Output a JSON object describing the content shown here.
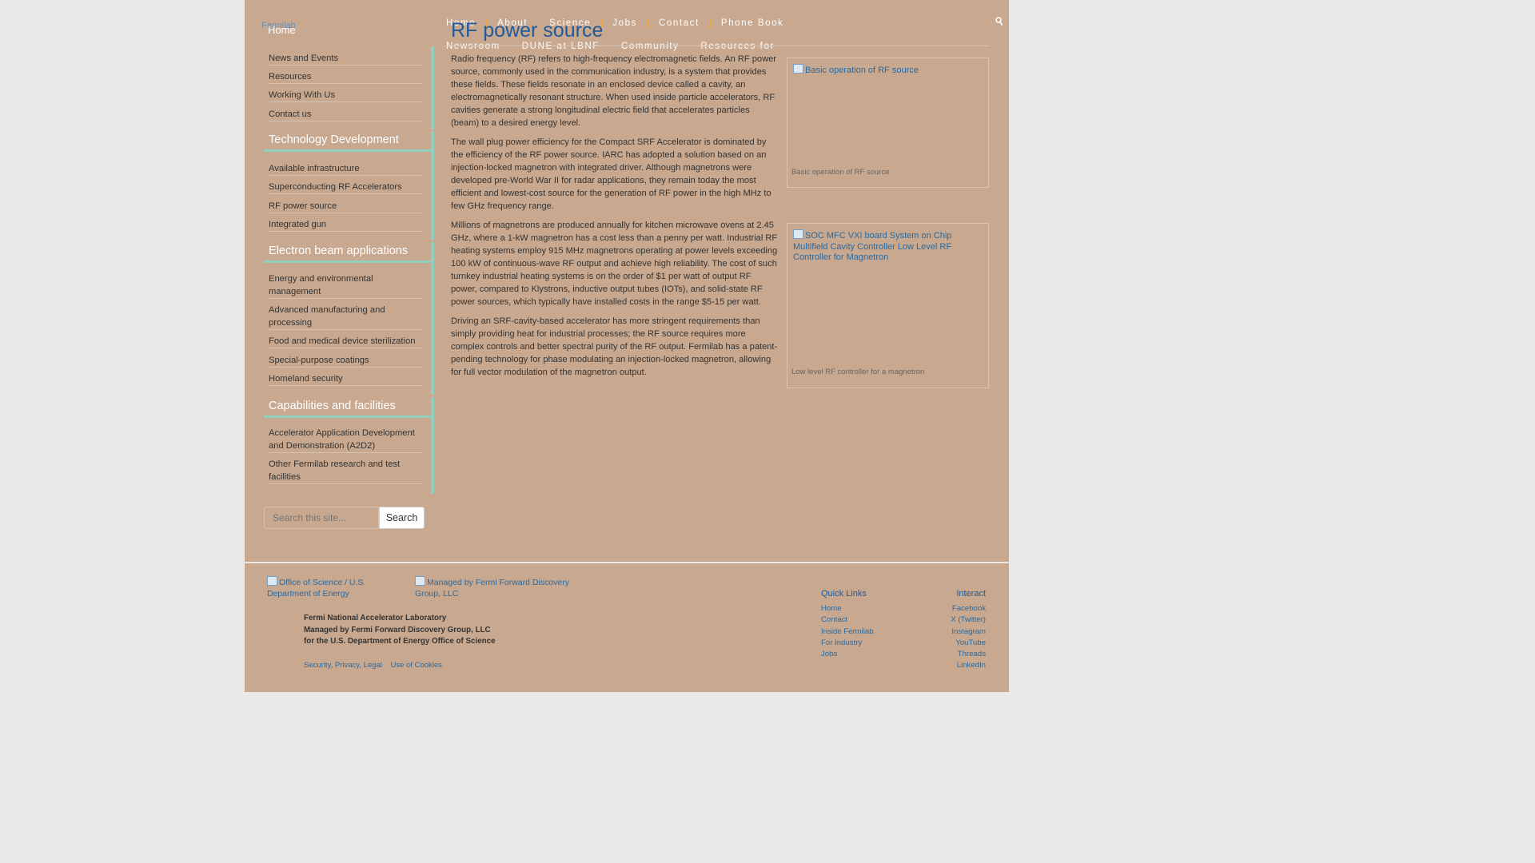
{
  "header": {
    "logo_alt": "Fermilab",
    "home_crumb": "Home",
    "nav_top": [
      "Home",
      "About",
      "Science",
      "Jobs",
      "Contact",
      "Phone Book"
    ],
    "nav_bottom": [
      "Newsroom",
      "DUNE at LBNF",
      "Community",
      "Resources for"
    ],
    "search_icon": "search-icon"
  },
  "sidebar": {
    "group1_items": [
      "News and Events",
      "Resources",
      "Working With Us",
      "Contact us"
    ],
    "group2": {
      "title": "Technology Development",
      "items": [
        "Available infrastructure",
        "Superconducting RF Accelerators",
        "RF power source",
        "Integrated gun"
      ]
    },
    "group3": {
      "title": "Electron beam applications",
      "items": [
        "Energy and environmental management",
        "Advanced manufacturing and processing",
        "Food and medical device sterilization",
        "Special-purpose coatings",
        "Homeland security"
      ]
    },
    "group4": {
      "title": "Capabilities and facilities",
      "items": [
        "Accelerator Application Development and Demonstration (A2D2)",
        "Other Fermilab research and test facilities"
      ]
    },
    "search": {
      "placeholder": "Search this site...",
      "button": "Search"
    }
  },
  "main": {
    "title": "RF power source",
    "paragraphs": [
      "Radio frequency (RF) refers to high-frequency electromagnetic fields. An RF power source, commonly used in the communication industry, is a system that provides these fields. These fields resonate in an enclosed device called a cavity, an electromagnetically resonant structure. When used inside particle accelerators, RF cavities generate a strong longitudinal electric field that accelerates particles (beam) to a desired energy level.",
      "The wall plug power efficiency for the Compact SRF Accelerator is dominated by the efficiency of the RF power source. IARC has adopted a solution based on an injection-locked magnetron with integrated driver. Although magnetrons were developed pre-World War II for radar applications, they remain today the most efficient and lowest-cost source for the generation of RF power in the high MHz to few GHz frequency range.",
      "Millions of magnetrons are produced annually for kitchen microwave ovens at 2.45 GHz, where a 1-kW magnetron has a cost less than a penny per watt. Industrial RF heating systems employ 915 MHz magnetrons operating at power levels exceeding 100 kW of continuous-wave RF output and achieve high reliability. The cost of such turnkey industrial heating systems is on the order of $1 per watt of output RF power, compared to Klystrons, inductive output tubes (IOTs), and solid-state RF power sources, which typically have installed costs in the range $5-15 per watt.",
      "Driving an SRF-cavity-based accelerator has more stringent requirements than simply providing heat for industrial processes; the RF source requires more complex controls and better spectral purity of the RF output. Fermilab has a patent-pending technology for phase modulating an injection-locked magnetron, allowing for full vector modulation of the magnetron output."
    ],
    "figures": [
      {
        "alt": "Basic operation of RF source",
        "caption": "Basic operation of RF source"
      },
      {
        "alt": "SOC MFC VXI board System on Chip Multifield Cavity Controller Low Level RF Controller for Magnetron",
        "caption": "Low level RF controller for a magnetron"
      }
    ]
  },
  "footer": {
    "logo_doe": "Office of Science / U.S. Department of Energy",
    "logo_ffdg": "Managed by Fermi Forward Discovery Group, LLC",
    "address": [
      "Fermi National Accelerator Laboratory",
      "Managed by Fermi Forward Discovery Group, LLC",
      "for the U.S. Department of Energy Office of Science"
    ],
    "legal": [
      "Security, Privacy, Legal",
      "Use of Cookies"
    ],
    "quick_links": {
      "title": "Quick Links",
      "items": [
        "Home",
        "Contact",
        "Inside Fermilab",
        "For Industry",
        "Jobs"
      ]
    },
    "interact": {
      "title": "Interact",
      "items": [
        "Facebook",
        "X (Twitter)",
        "Instagram",
        "YouTube",
        "Threads",
        "LinkedIn"
      ]
    }
  },
  "colors": {
    "page_bg": "#c8a88f",
    "accent_bar": "#8ed0bd",
    "nav_separator": "#e8a33d",
    "title_blue": "#1f5a9a"
  }
}
